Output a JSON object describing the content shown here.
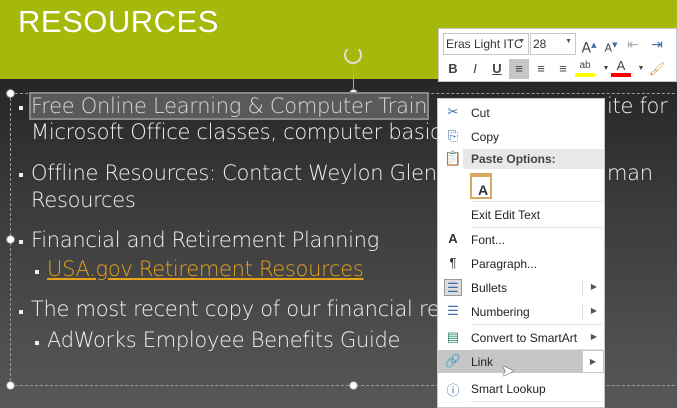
{
  "slide": {
    "title": "RESOURCES",
    "lines": [
      "Free Online Learning & Computer Train",
      "ite for",
      "Microsoft Office classes,  computer basic",
      "Offline Resources: Contact Weylon Glen",
      "man",
      "Resources",
      "Financial and Retirement Planning",
      "USA.gov Retirement Resources",
      "The most recent copy of our financial re",
      "AdWorks Employee Benefits Guide"
    ]
  },
  "mini_toolbar": {
    "font": "Eras Light ITC",
    "size": "28",
    "buttons": [
      "B",
      "I",
      "U"
    ],
    "colors": {
      "highlight": "#ffff00",
      "font_color": "#ff0000"
    }
  },
  "context_menu": {
    "items": [
      {
        "label": "Cut",
        "icon": "scissors-icon"
      },
      {
        "label": "Copy",
        "icon": "copy-icon"
      },
      {
        "label": "Paste Options:",
        "icon": "paste-icon"
      },
      {
        "label": "Exit Edit Text"
      },
      {
        "label": "Font...",
        "icon": "font-icon",
        "glyph": "A"
      },
      {
        "label": "Paragraph...",
        "icon": "paragraph-icon"
      },
      {
        "label": "Bullets",
        "icon": "bullets-icon"
      },
      {
        "label": "Numbering",
        "icon": "numbering-icon"
      },
      {
        "label": "Convert to SmartArt",
        "icon": "smartart-icon"
      },
      {
        "label": "Link",
        "icon": "link-icon"
      },
      {
        "label": "Smart Lookup",
        "icon": "smart-lookup-icon"
      }
    ]
  }
}
